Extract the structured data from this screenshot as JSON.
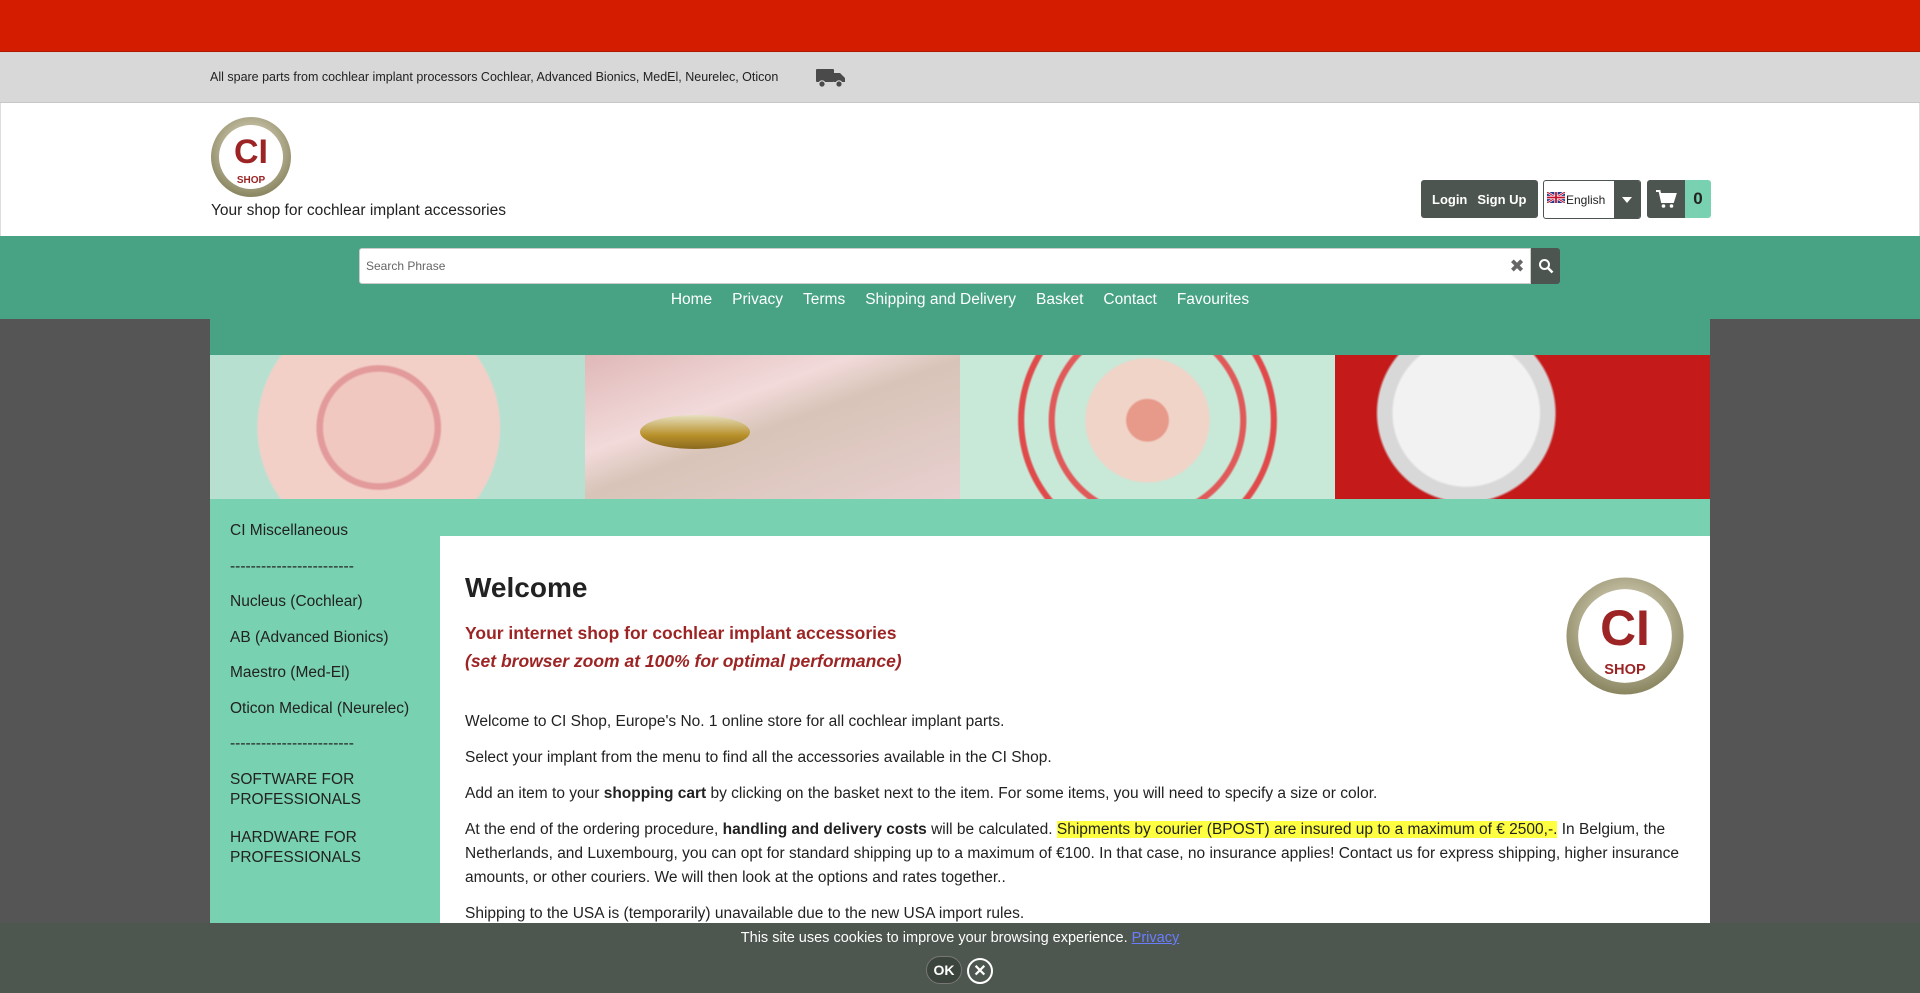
{
  "infobar": {
    "text": "All spare parts from cochlear implant processors Cochlear, Advanced Bionics, MedEl, Neurelec, Oticon",
    "icon": "truck-icon"
  },
  "header": {
    "logo_text": "CI",
    "logo_sub": "SHOP",
    "tagline": "Your shop for cochlear implant accessories",
    "login": "Login",
    "signup": "Sign Up",
    "language": "English",
    "cart_count": "0"
  },
  "search": {
    "placeholder": "Search Phrase"
  },
  "menu": [
    "Home",
    "Privacy",
    "Terms",
    "Shipping and Delivery",
    "Basket",
    "Contact",
    "Favourites"
  ],
  "sidebar": [
    "CI Miscellaneous",
    "------------------------",
    "Nucleus (Cochlear)",
    "AB (Advanced Bionics)",
    "Maestro (Med-El)",
    "Oticon Medical (Neurelec)",
    "------------------------",
    "SOFTWARE FOR PROFESSIONALS",
    "HARDWARE FOR PROFESSIONALS"
  ],
  "content": {
    "title": "Welcome",
    "subtitle1": "Your internet shop for cochlear implant accessories",
    "subtitle2": "(set browser zoom at 100% for optimal performance)",
    "p1": "Welcome to CI Shop, Europe's No. 1 online store for all cochlear implant parts.",
    "p2": "Select your implant from the menu to find all the accessories available in the CI Shop.",
    "p3_a": "Add an item to your ",
    "p3_b": "shopping cart",
    "p3_c": " by clicking on the basket next to the item. For some items, you will need to specify a size or color.",
    "p4_a": "At the end of the ordering procedure, ",
    "p4_b": "handling and delivery costs",
    "p4_c": " will be calculated.  ",
    "p4_hl": "Shipments by courier (BPOST) are insured up to a maximum of € 2500,-.",
    "p4_d": " In Belgium, the Netherlands, and Luxembourg, you can opt for standard shipping up to a maximum of €100. In that case, no insurance applies! Contact us for express shipping, higher insurance amounts, or other couriers. We will then look at the options and rates together..",
    "p5": "Shipping to the USA is (temporarily) unavailable due to the new USA import rules."
  },
  "cookie": {
    "text": "This site uses cookies to improve your browsing experience.",
    "link": "Privacy",
    "ok": "OK"
  },
  "colors": {
    "topbar": "#d41c00",
    "green": "#47a383",
    "mint": "#78d1b1",
    "dark": "#4d5550",
    "accent_text": "#9c2424",
    "highlight": "#ffff42"
  }
}
